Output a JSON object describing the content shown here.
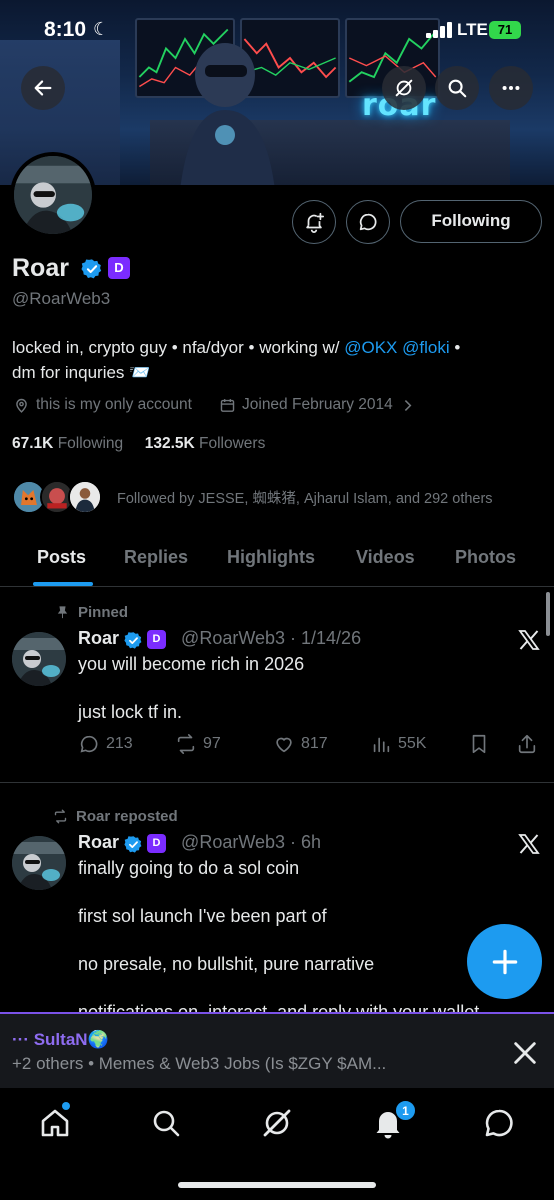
{
  "status_bar": {
    "time": "8:10",
    "network": "LTE",
    "battery": "71"
  },
  "banner": {
    "neon_text": "roar"
  },
  "profile": {
    "name": "Roar",
    "handle": "@RoarWeb3",
    "badge_d": "D",
    "follow_button": "Following",
    "bio_text": "locked in, crypto guy • nfa/dyor • working w/ ",
    "bio_mention_1": "@OKX",
    "bio_mention_2": "@floki",
    "bio_suffix": " •",
    "bio_line2": "dm for inquries 📨",
    "location": "this is my only account",
    "joined": "Joined February 2014",
    "following_count": "67.1K",
    "following_label": "Following",
    "followers_count": "132.5K",
    "followers_label": "Followers",
    "followed_by": "Followed by JESSE, 蜘蛛猪, Ajharul Islam, and 292 others"
  },
  "tabs": [
    "Posts",
    "Replies",
    "Highlights",
    "Videos",
    "Photos"
  ],
  "posts": [
    {
      "label": "Pinned",
      "name": "Roar",
      "meta": "@RoarWeb3 · 1/14/26",
      "lines": [
        "you will become rich in 2026",
        "",
        " just lock tf in."
      ],
      "replies": "213",
      "reposts": "97",
      "likes": "817",
      "views": "55K"
    },
    {
      "label": "Roar reposted",
      "name": "Roar",
      "meta": "@RoarWeb3 · 6h",
      "lines": [
        "finally going to do a sol coin",
        "",
        "first sol launch I've been part of",
        "",
        "no presale, no bullshit, pure narrative",
        "",
        "notifications on, interact, and reply with your wallet"
      ]
    }
  ],
  "chat": {
    "who": "··· SultaN🌍",
    "line2": "+2 others • Memes & Web3 Jobs (Is $ZGY $AM..."
  },
  "nav": {
    "notif_count": "1"
  }
}
